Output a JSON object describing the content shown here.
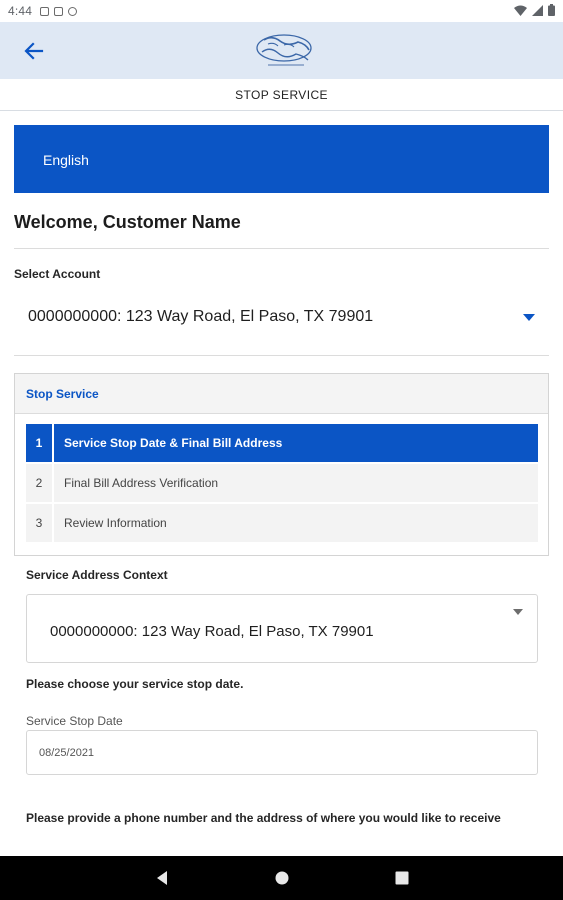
{
  "status_bar": {
    "time": "4:44"
  },
  "header": {
    "page_title": "STOP SERVICE"
  },
  "language": {
    "label": "English"
  },
  "welcome": "Welcome, Customer Name",
  "account": {
    "label": "Select Account",
    "selected": "0000000000: 123 Way Road, El Paso, TX 79901"
  },
  "stop_service": {
    "title": "Stop Service",
    "steps": [
      {
        "number": "1",
        "label": "Service Stop Date & Final Bill Address"
      },
      {
        "number": "2",
        "label": "Final Bill Address Verification"
      },
      {
        "number": "3",
        "label": "Review Information"
      }
    ],
    "active_step": 1
  },
  "service_address": {
    "label": "Service Address Context",
    "selected": "0000000000: 123 Way Road, El Paso, TX 79901"
  },
  "stop_date": {
    "prompt": "Please choose your service stop date.",
    "label": "Service Stop Date",
    "value": "08/25/2021"
  },
  "phone_prompt": "Please provide a phone number and the address of where you would like to receive",
  "colors": {
    "primary": "#0b55c5",
    "app_bar": "#dfe8f4",
    "nav_bar": "#000000"
  }
}
